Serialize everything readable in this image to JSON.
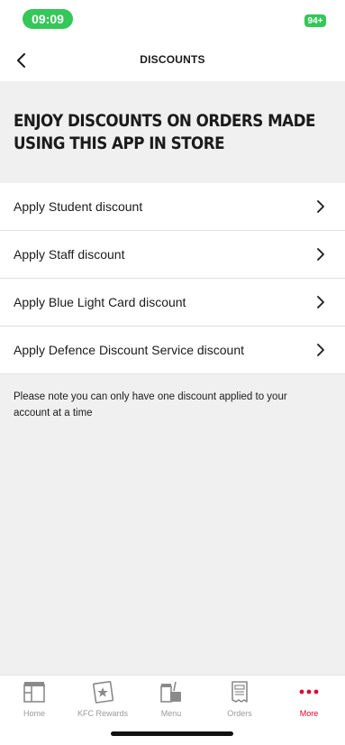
{
  "status_bar": {
    "time": "09:09",
    "battery": "94+"
  },
  "header": {
    "title": "DISCOUNTS",
    "back_icon": "chevron-left-icon"
  },
  "banner": {
    "title": "ENJOY DISCOUNTS ON ORDERS MADE USING THIS APP IN STORE"
  },
  "discounts": [
    {
      "label": "Apply Student discount"
    },
    {
      "label": "Apply Staff discount"
    },
    {
      "label": "Apply Blue Light Card discount"
    },
    {
      "label": "Apply Defence Discount Service discount"
    }
  ],
  "note": "Please note you can only have one discount applied to your account at a time",
  "tab_bar": {
    "tabs": [
      {
        "label": "Home",
        "icon": "home-icon",
        "active": false
      },
      {
        "label": "KFC Rewards",
        "icon": "rewards-card-icon",
        "active": false
      },
      {
        "label": "Menu",
        "icon": "menu-food-icon",
        "active": false
      },
      {
        "label": "Orders",
        "icon": "receipt-icon",
        "active": false
      },
      {
        "label": "More",
        "icon": "more-dots-icon",
        "active": true
      }
    ]
  },
  "colors": {
    "accent": "#e4002b",
    "status_green": "#34c759",
    "background_grey": "#f0f0f0",
    "text": "#1b1b1b",
    "inactive": "#9a9a9a"
  }
}
